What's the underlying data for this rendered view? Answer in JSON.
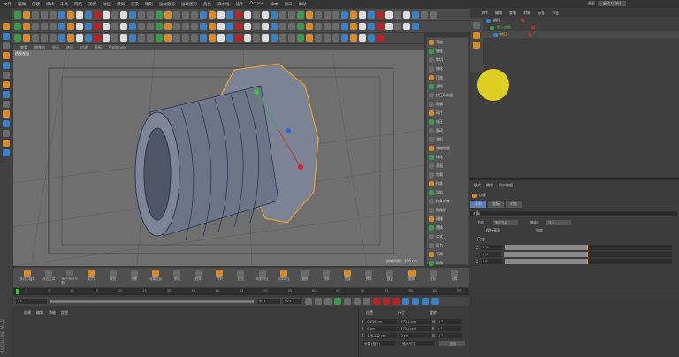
{
  "menu": [
    "文件",
    "编辑",
    "创建",
    "模式",
    "工具",
    "网格",
    "捕捉",
    "动画",
    "模拟",
    "渲染",
    "雕刻",
    "运动跟踪",
    "运动图形",
    "角色",
    "流水线",
    "插件",
    "Octane",
    "脚本",
    "窗口",
    "帮助"
  ],
  "layout": {
    "label": "界面",
    "value": "启动 (用户)"
  },
  "viewport": {
    "menu": [
      "查看",
      "摄像机",
      "显示",
      "选项",
      "过滤",
      "面板",
      "ProRender"
    ],
    "name": "透视视图",
    "grid_spacing": "网格间距：100 cm"
  },
  "palette": [
    "弯曲",
    "膨胀",
    "斜切",
    "锥化",
    "扭曲",
    "晶格",
    "挤压&伸展",
    "融解",
    "碎片",
    "修正",
    "颤动",
    "变形",
    "收缩包裹",
    "球化",
    "表面",
    "包裹",
    "样条",
    "导轨",
    "样条约束",
    "摄像机",
    "碰撞",
    "置换",
    "公式",
    "风力",
    "平滑",
    "倒角"
  ],
  "objects": {
    "tabs": [
      "文件",
      "编辑",
      "查看",
      "对象",
      "标签",
      "书签"
    ],
    "items": [
      {
        "name": "圆柱"
      },
      {
        "name": "细分曲面"
      },
      {
        "name": "挤压"
      }
    ]
  },
  "attributes": {
    "tabs": [
      "模式",
      "编辑",
      "用户数据"
    ],
    "object": "挤压",
    "subtabs": [
      "基本",
      "坐标",
      "对象"
    ],
    "section": "对象",
    "fields": [
      {
        "label": "方向",
        "value": "固定方向"
      },
      {
        "label": "轴向",
        "value": "自由"
      }
    ],
    "checks": [
      "保持表面",
      "强度"
    ],
    "group": "尺寸",
    "sliders": [
      {
        "axis": "X",
        "value": "0 %",
        "fill": 50
      },
      {
        "axis": "Y",
        "value": "0 %",
        "fill": 50
      },
      {
        "axis": "Z",
        "value": "0 %",
        "fill": 50
      }
    ]
  },
  "bottom_tools": [
    "多边形画笔",
    "闭合孔洞",
    "循环/路径切割",
    "切刀",
    "磁铁",
    "镜像",
    "设置点值",
    "滑动",
    "熨烫",
    "阵列",
    "挤压",
    "内部挤压",
    "矩阵挤压",
    "偏移",
    "倒角",
    "桥接",
    "焊接",
    "缝合",
    "缩放",
    "优化",
    "分裂"
  ],
  "timeline": {
    "ticks": [
      "0",
      "5",
      "10",
      "15",
      "20",
      "25",
      "30",
      "35",
      "40",
      "45",
      "50",
      "55",
      "60",
      "65",
      "70",
      "75",
      "80",
      "85",
      "90"
    ],
    "start": "0 F",
    "end": "90 F",
    "current": "0 F",
    "max": "90 F"
  },
  "materials": {
    "menu": [
      "创建",
      "编辑",
      "功能",
      "纹理"
    ]
  },
  "coords": {
    "headers": [
      "位置",
      "尺寸",
      "旋转"
    ],
    "rows": [
      {
        "axis": "X",
        "pos": "0.016 cm",
        "size": "573.6 cm",
        "rl": "H",
        "rot": "0 °"
      },
      {
        "axis": "Y",
        "pos": "0 cm",
        "size": "573.6 cm",
        "rl": "P",
        "rot": "0 °"
      },
      {
        "axis": "Z",
        "pos": "106.222 cm",
        "size": "0 cm",
        "rl": "B",
        "rot": "0 °"
      }
    ],
    "mode": "对象 (相对)",
    "size_mode": "绝对尺寸",
    "apply": "应用"
  },
  "brand": "MAXON CINEMA 4D"
}
